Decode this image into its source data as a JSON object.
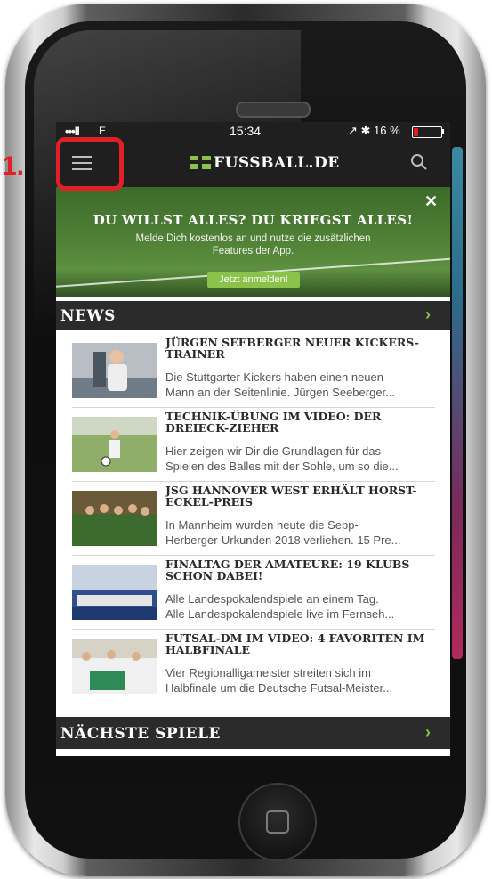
{
  "status_bar": {
    "signal": "•••ll",
    "carrier": "E",
    "time": "15:34",
    "right_indicators": "↗ ✱ 16 %",
    "battery_percent": 16
  },
  "app_header": {
    "logo_text": "FUSSBALL.DE"
  },
  "promo": {
    "title": "DU WILLST ALLES? DU KRIEGST ALLES!",
    "text": "Melde Dich kostenlos an und nutze die zusätzlichen Features der App.",
    "button_label": "Jetzt anmelden!",
    "close_label": "✕"
  },
  "news_section": {
    "title": "NEWS",
    "chevron": "›",
    "items": [
      {
        "title": "JÜRGEN SEEBERGER NEUER KICKERS-TRAINER",
        "line1": "Die Stuttgarter Kickers haben einen neuen",
        "line2": "Mann an der Seitenlinie. Jürgen Seeberger..."
      },
      {
        "title": "TECHNIK-ÜBUNG IM VIDEO: DER DREIECK-ZIEHER",
        "line1": "Hier zeigen wir Dir die Grundlagen für das",
        "line2": "Spielen des Balles mit der Sohle, um so die..."
      },
      {
        "title": "JSG HANNOVER WEST ERHÄLT HORST-ECKEL-PREIS",
        "line1": "In Mannheim wurden heute die Sepp-",
        "line2": "Herberger-Urkunden 2018 verliehen. 15 Pre..."
      },
      {
        "title": "FINALTAG DER AMATEURE: 19 KLUBS SCHON DABEI!",
        "line1": "Alle Landespokalendspiele an einem Tag.",
        "line2": "Alle Landespokalendspiele live im Fernseh..."
      },
      {
        "title": "FUTSAL-DM IM VIDEO: 4 FAVORITEN IM HALBFINALE",
        "line1": "Vier Regionalligameister streiten sich im",
        "line2": "Halbfinale um die Deutsche Futsal-Meister..."
      }
    ]
  },
  "next_games_section": {
    "title": "NÄCHSTE SPIELE",
    "chevron": "›"
  },
  "annotation": {
    "label": "1."
  },
  "colors": {
    "accent_green": "#8bc34a",
    "header_dark": "#1f1f1f",
    "annotation_red": "#e01f26"
  },
  "icons": [
    "menu-icon",
    "search-icon",
    "close-icon",
    "chevron-right-icon",
    "battery-icon",
    "home-button-icon"
  ]
}
